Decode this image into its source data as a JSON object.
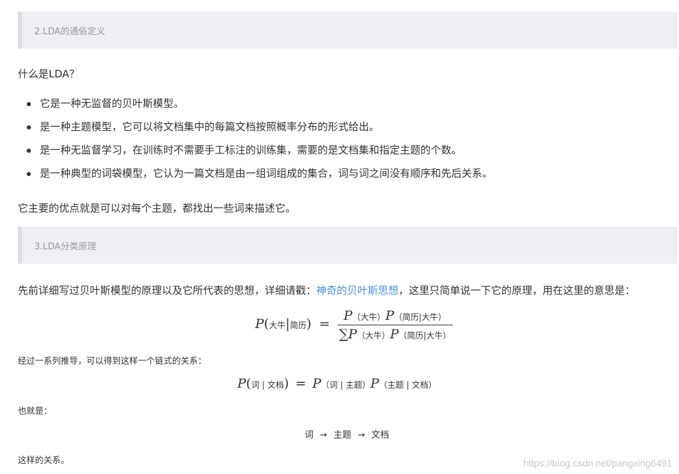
{
  "section2": {
    "title": "2.LDA的通俗定义"
  },
  "intro_question": "什么是LDA？",
  "bullets": [
    "它是一种无监督的贝叶斯模型。",
    "是一种主题模型，它可以将文档集中的每篇文档按照概率分布的形式给出。",
    "是一种无监督学习，在训练时不需要手工标注的训练集，需要的是文档集和指定主题的个数。",
    "是一种典型的词袋模型，它认为一篇文档是由一组词组成的集合，词与词之间没有顺序和先后关系。"
  ],
  "advantage": "它主要的优点就是可以对每个主题，都找出一些词来描述它。",
  "section3": {
    "title": "3.LDA分类原理"
  },
  "bayes_para": {
    "before": "先前详细写过贝叶斯模型的原理以及它所代表的思想，详细请戳：",
    "link_text": "神奇的贝叶斯思想",
    "after": "，这里只简单说一下它的原理，用在这里的意思是："
  },
  "formula1": {
    "lhs_P": "P",
    "lhs_arg1": "大牛",
    "lhs_arg2": "简历",
    "eq": "=",
    "num_P1": "P",
    "num_arg1": "大牛",
    "num_P2": "P",
    "num_arg2a": "简历",
    "num_arg2b": "大牛",
    "den_sum": "∑",
    "den_P1": "P",
    "den_arg1": "大牛",
    "den_P2": "P",
    "den_arg2a": "简历",
    "den_arg2b": "大牛"
  },
  "derive_text": "经过一系列推导，可以得到这样一个链式的关系：",
  "formula2": {
    "P": "P",
    "w": "词",
    "doc": "文档",
    "eq": "=",
    "topic": "主题"
  },
  "also_text": "也就是：",
  "chain": {
    "w": "词",
    "arrow": "→",
    "topic": "主题",
    "doc": "文档"
  },
  "final_text": "这样的关系。",
  "watermark": "https://blog.csdn.net/pangxing6491"
}
